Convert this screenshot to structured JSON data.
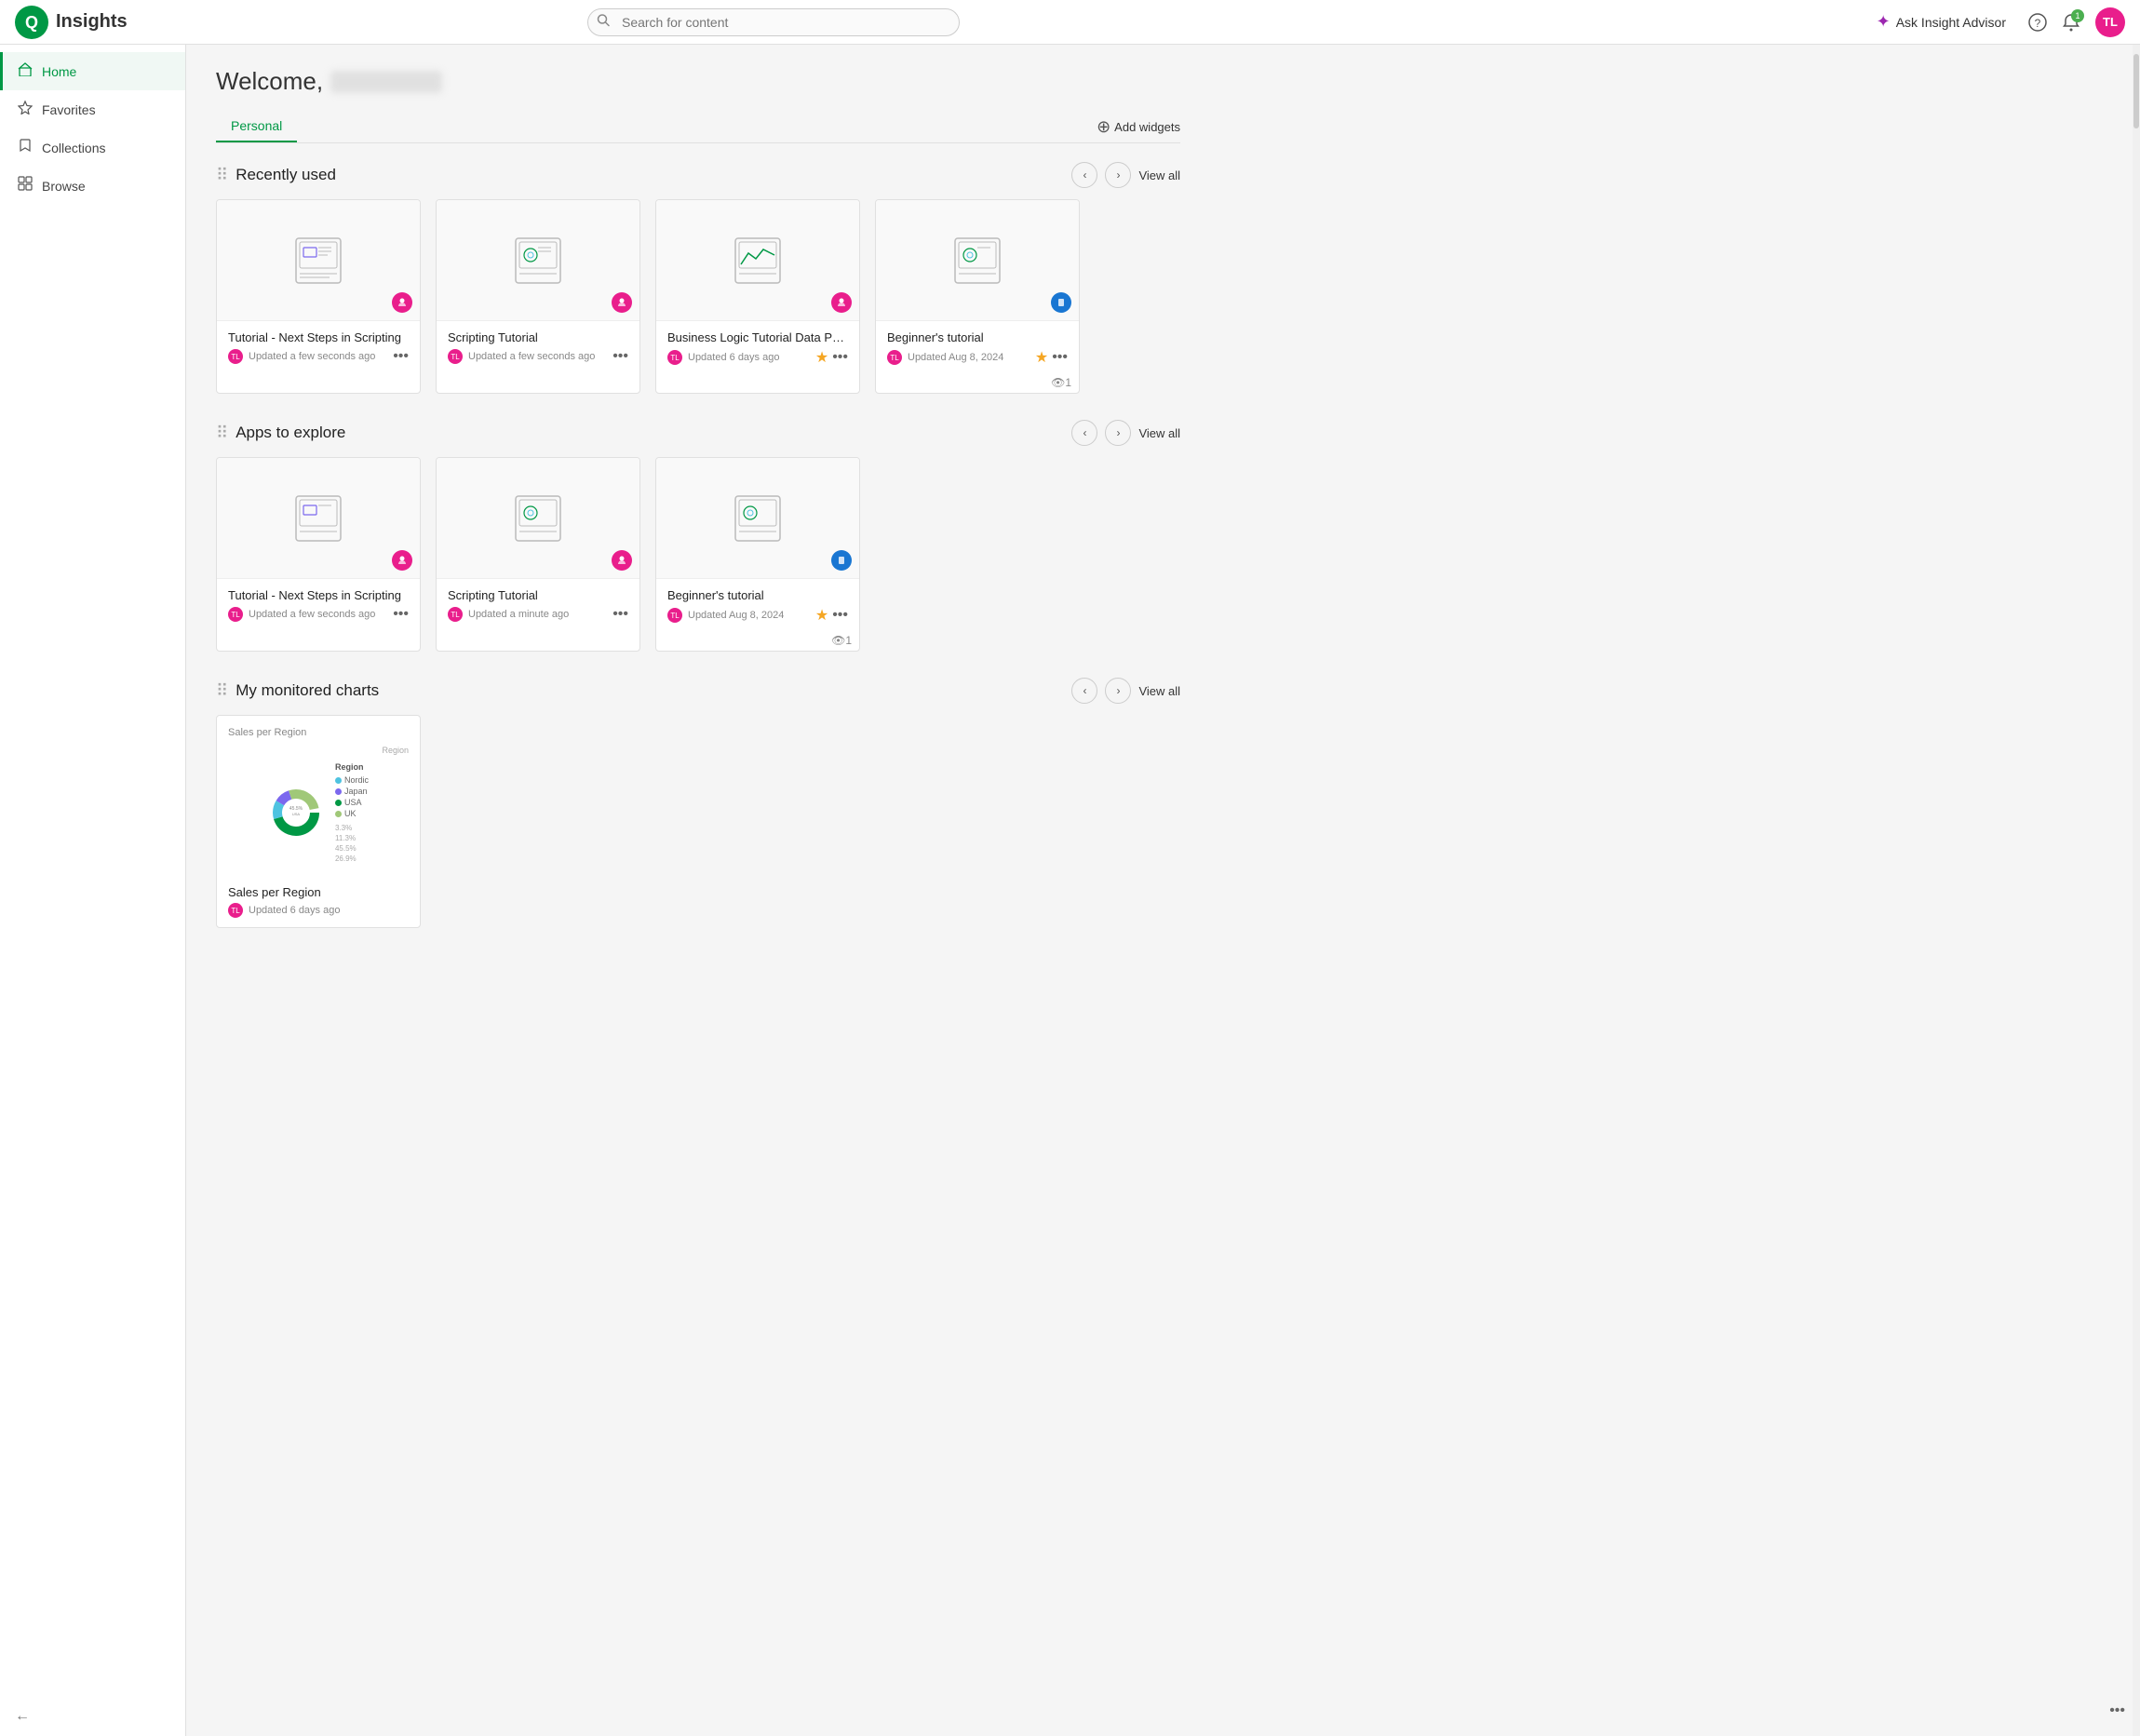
{
  "topnav": {
    "app_name": "Insights",
    "search_placeholder": "Search for content",
    "ask_advisor_label": "Ask Insight Advisor",
    "notification_count": "1",
    "avatar_initials": "TL"
  },
  "sidebar": {
    "items": [
      {
        "id": "home",
        "label": "Home",
        "icon": "home"
      },
      {
        "id": "favorites",
        "label": "Favorites",
        "icon": "star"
      },
      {
        "id": "collections",
        "label": "Collections",
        "icon": "bookmark"
      },
      {
        "id": "browse",
        "label": "Browse",
        "icon": "grid"
      }
    ],
    "active": "home",
    "collapse_label": "Collapse"
  },
  "main": {
    "welcome_prefix": "Welcome,",
    "tabs": [
      {
        "id": "personal",
        "label": "Personal",
        "active": true
      }
    ],
    "add_widgets_label": "Add widgets",
    "sections": [
      {
        "id": "recently-used",
        "title": "Recently used",
        "view_all": "View all",
        "cards": [
          {
            "title": "Tutorial - Next Steps in Scripting",
            "updated": "Updated a few seconds ago",
            "starred": false,
            "owner_type": "person",
            "owner_color": "pink"
          },
          {
            "title": "Scripting Tutorial",
            "updated": "Updated a few seconds ago",
            "starred": false,
            "owner_type": "person",
            "owner_color": "pink"
          },
          {
            "title": "Business Logic Tutorial Data Prep",
            "updated": "Updated 6 days ago",
            "starred": true,
            "owner_type": "person",
            "owner_color": "pink"
          },
          {
            "title": "Beginner's tutorial",
            "updated": "Updated Aug 8, 2024",
            "starred": true,
            "owner_type": "person",
            "owner_color": "blue",
            "view_count": "1"
          }
        ]
      },
      {
        "id": "apps-to-explore",
        "title": "Apps to explore",
        "view_all": "View all",
        "cards": [
          {
            "title": "Tutorial - Next Steps in Scripting",
            "updated": "Updated a few seconds ago",
            "starred": false,
            "owner_type": "person",
            "owner_color": "pink"
          },
          {
            "title": "Scripting Tutorial",
            "updated": "Updated a minute ago",
            "starred": false,
            "owner_type": "person",
            "owner_color": "pink"
          },
          {
            "title": "Beginner's tutorial",
            "updated": "Updated Aug 8, 2024",
            "starred": true,
            "owner_type": "person",
            "owner_color": "blue",
            "view_count": "1"
          }
        ]
      },
      {
        "id": "my-monitored-charts",
        "title": "My monitored charts",
        "view_all": "View all",
        "chart_cards": [
          {
            "title": "Sales per Region",
            "chart_label": "Region",
            "updated": "Updated 6 days ago",
            "owner_color": "pink",
            "segments": [
              {
                "label": "USA",
                "value": 45.5,
                "color": "#009845"
              },
              {
                "label": "Nordic",
                "value": 13.3,
                "color": "#4ec3e0"
              },
              {
                "label": "Japan",
                "value": 11.3,
                "color": "#7b68ee"
              },
              {
                "label": "UK",
                "value": 26.9,
                "color": "#a0c878"
              }
            ]
          }
        ]
      }
    ]
  }
}
